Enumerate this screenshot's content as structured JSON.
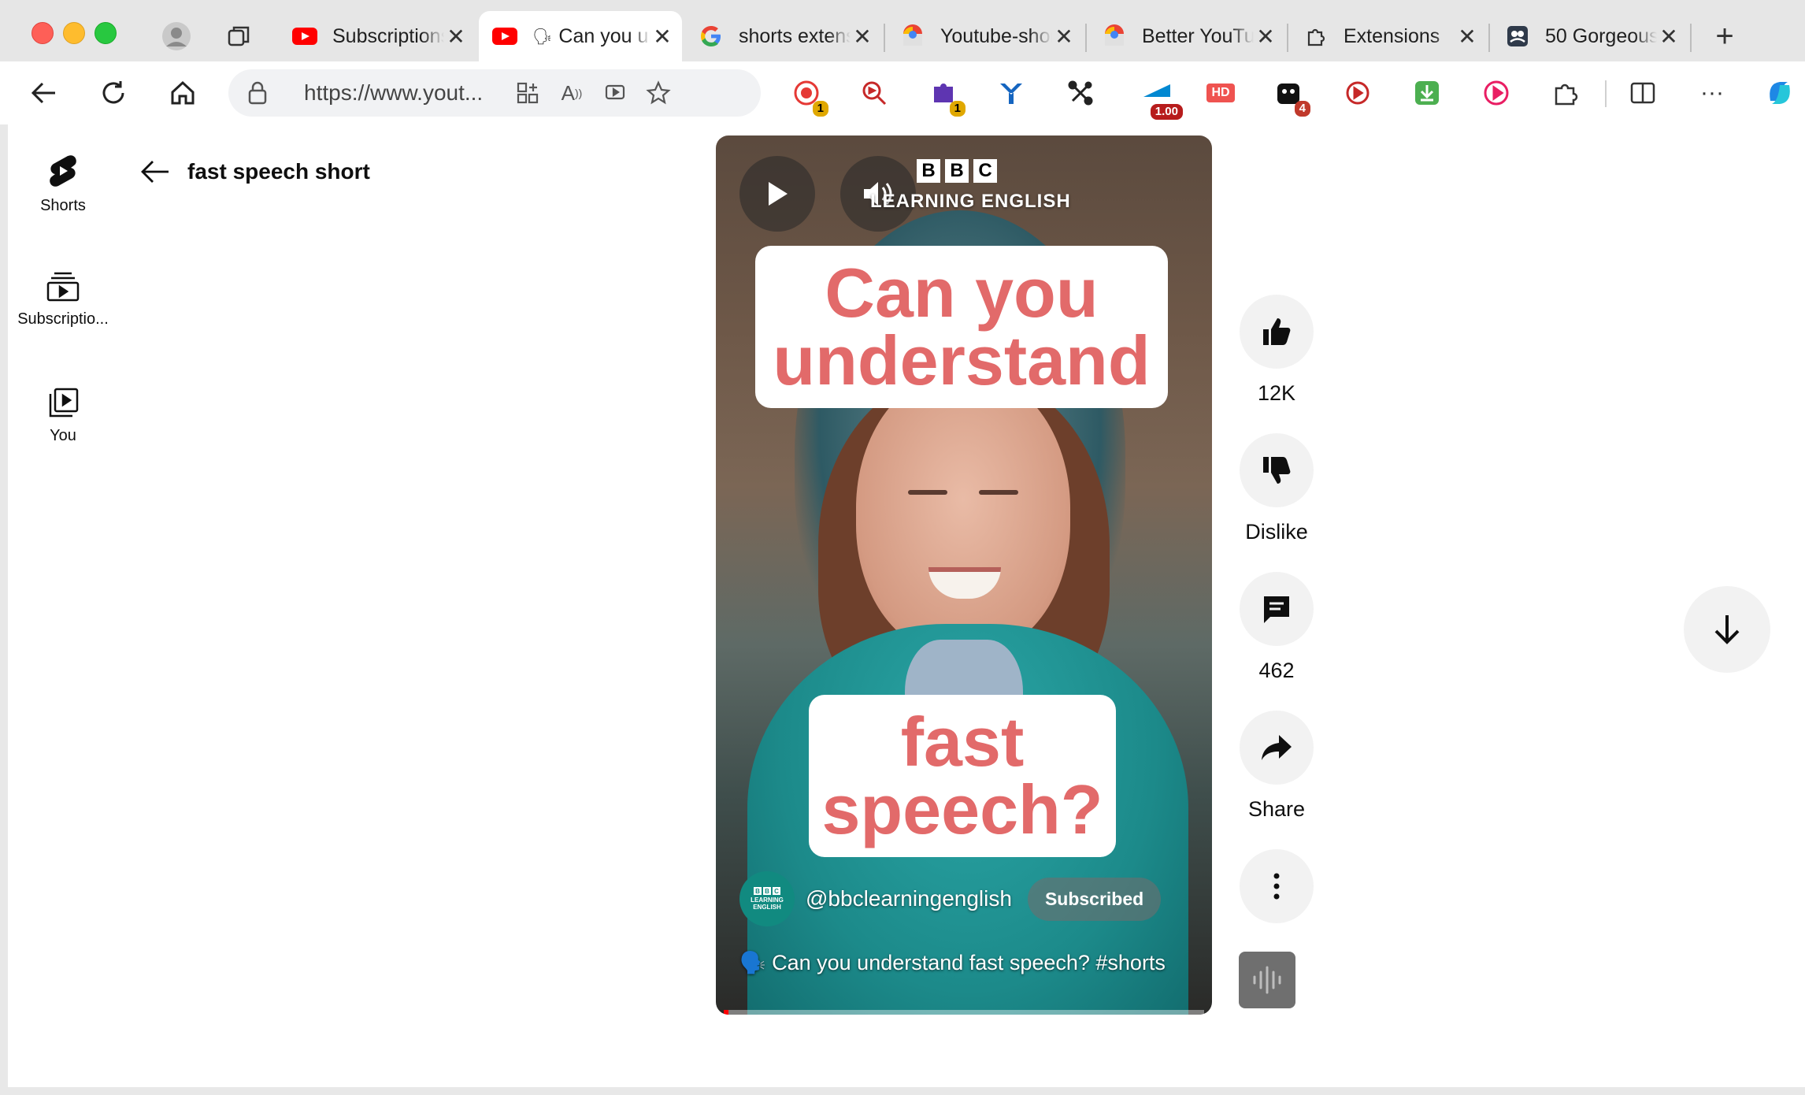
{
  "browser": {
    "tabs": [
      {
        "title": "Subscriptions - YouTube",
        "favicon": "youtube-icon"
      },
      {
        "title": "Can you understand fast speech?",
        "favicon": "youtube-icon",
        "active": true
      },
      {
        "title": "shorts extension",
        "favicon": "google-icon"
      },
      {
        "title": "Youtube-shorts",
        "favicon": "chrome-store-icon"
      },
      {
        "title": "Better YouTube",
        "favicon": "chrome-store-icon"
      },
      {
        "title": "Extensions",
        "favicon": "puzzle-icon"
      },
      {
        "title": "50 Gorgeous",
        "favicon": "gallery-icon"
      }
    ],
    "url": "https://www.yout...",
    "extensions": {
      "badge_1": "1",
      "badge_2": "1",
      "speed": "1.00",
      "hd": "HD",
      "badge_4": "4"
    }
  },
  "sidebar": {
    "items": [
      {
        "label": "Shorts"
      },
      {
        "label": "Subscriptio..."
      },
      {
        "label": "You"
      }
    ]
  },
  "search": {
    "query": "fast speech short"
  },
  "video": {
    "brand_letters": [
      "B",
      "B",
      "C"
    ],
    "brand_sub": "LEARNING ENGLISH",
    "caption_top": [
      "Can you",
      "understand"
    ],
    "caption_bottom": [
      "fast",
      "speech?"
    ],
    "channel": "@bbclearningenglish",
    "subscribe_label": "Subscribed",
    "title": "🗣️ Can you understand fast speech? #shorts",
    "avatar_text": [
      "LEARNING",
      "ENGLISH"
    ],
    "progress": 0.01
  },
  "actions": {
    "likes": "12K",
    "dislike": "Dislike",
    "comments": "462",
    "share": "Share"
  },
  "colors": {
    "caption_text": "#e26a6a",
    "accent_red": "#ff0000",
    "channel_avatar": "#118a80"
  }
}
